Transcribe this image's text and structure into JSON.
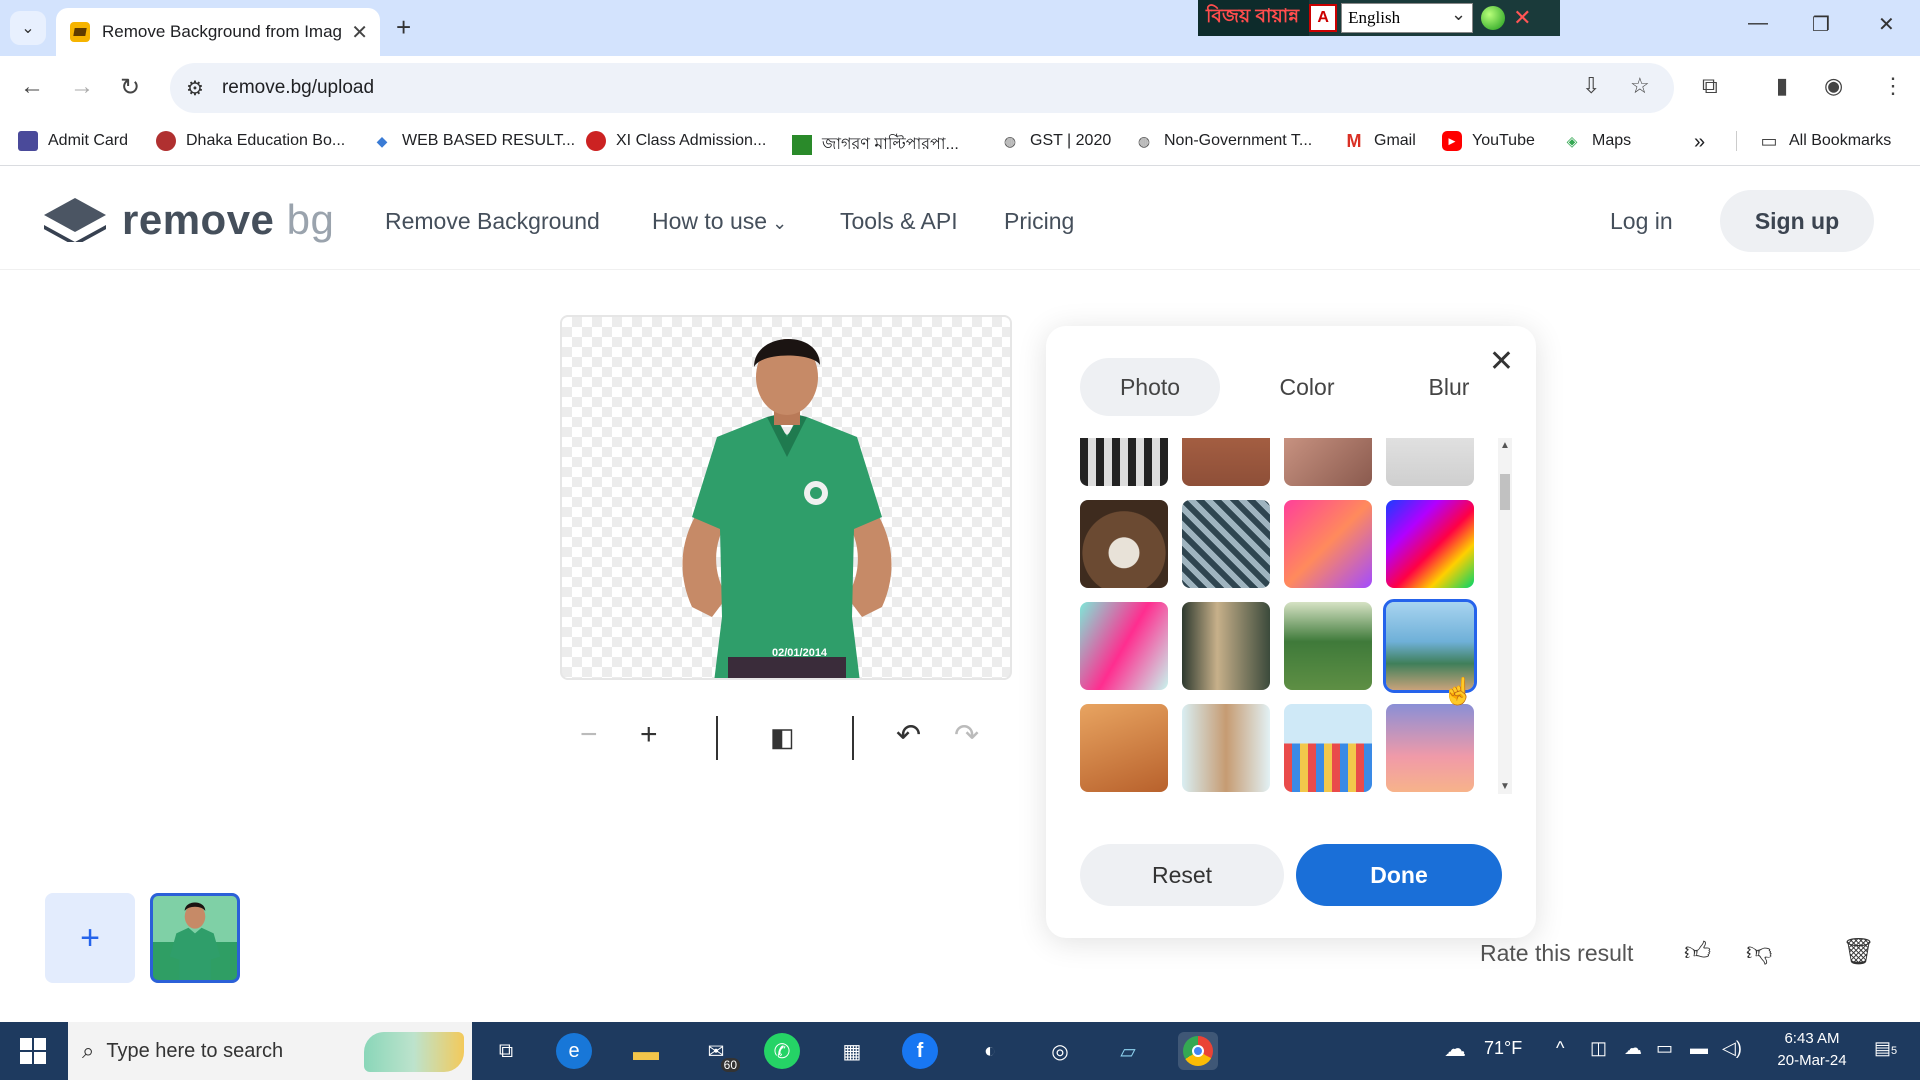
{
  "browser": {
    "tab_title": "Remove Background from Imag",
    "url": "remove.bg/upload",
    "ext_bangla": "বিজয় বায়ান্ন",
    "ext_pdf": "A",
    "ext_language": "English",
    "bookmarks": [
      {
        "label": "Admit Card",
        "color": "#4a4a9a"
      },
      {
        "label": "Dhaka Education Bo...",
        "color": "#b03030"
      },
      {
        "label": "WEB BASED RESULT...",
        "color": "#3a7bd5"
      },
      {
        "label": "XI Class Admission...",
        "color": "#cc2222"
      },
      {
        "label": "জাগরণ মাল্টিপারপা...",
        "color": "#2a8a2a"
      },
      {
        "label": "GST | 2020",
        "color": "#555555"
      },
      {
        "label": "Non-Government T...",
        "color": "#555555"
      },
      {
        "label": "Gmail",
        "color": "#d93025"
      },
      {
        "label": "YouTube",
        "color": "#ff0000"
      },
      {
        "label": "Maps",
        "color": "#34a853"
      }
    ],
    "all_bookmarks": "All Bookmarks",
    "more_bookmarks": "»"
  },
  "site": {
    "logo_main": "remove",
    "logo_accent": "bg",
    "nav": {
      "remove_background": "Remove Background",
      "how_to_use": "How to use",
      "tools_api": "Tools & API",
      "pricing": "Pricing"
    },
    "login": "Log in",
    "signup": "Sign up"
  },
  "editor": {
    "photo_stamp": "02/01/2014",
    "rate_label": "Rate this result"
  },
  "modal": {
    "tabs": [
      "Photo",
      "Color",
      "Blur"
    ],
    "active_tab": "Photo",
    "reset_label": "Reset",
    "done_label": "Done",
    "selected_index": 11,
    "accent_color": "#1a6fd8"
  },
  "taskbar": {
    "search_placeholder": "Type here to search",
    "mail_badge": "60",
    "weather": "71°F",
    "time": "6:43 AM",
    "date": "20-Mar-24",
    "notifications": "5"
  }
}
